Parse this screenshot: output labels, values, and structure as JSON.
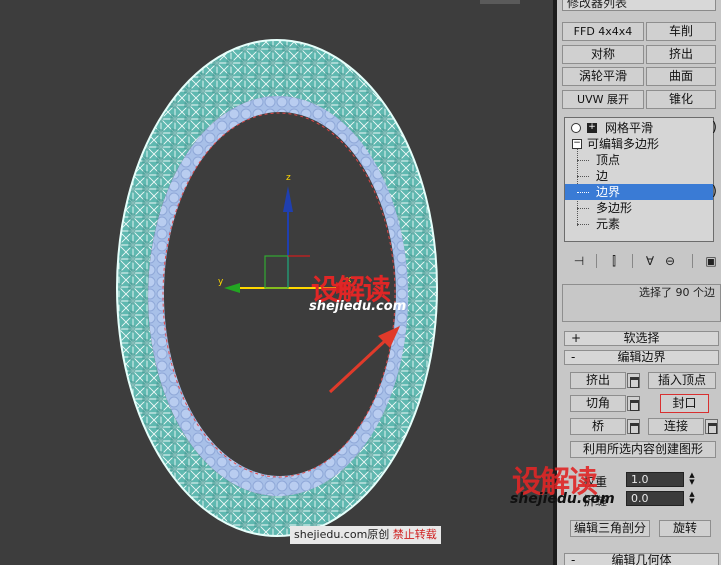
{
  "panel": {
    "modifier_list": "修改器列表",
    "modifier_buttons": [
      {
        "label": "FFD 4x4x4"
      },
      {
        "label": "车削"
      },
      {
        "label": "对称"
      },
      {
        "label": "挤出"
      },
      {
        "label": "涡轮平滑"
      },
      {
        "label": "曲面"
      },
      {
        "label": "UVW 展开"
      },
      {
        "label": "锥化"
      }
    ],
    "stack": {
      "items": [
        {
          "label": "网格平滑"
        },
        {
          "label": "可编辑多边形"
        },
        {
          "label": "顶点"
        },
        {
          "label": "边"
        },
        {
          "label": "边界"
        },
        {
          "label": "多边形"
        },
        {
          "label": "元素"
        }
      ],
      "selected_index": 4
    },
    "selection_info": "选择了 90 个边",
    "soft_selection": "软选择",
    "edit_borders": {
      "title": "编辑边界",
      "extrude": "挤出",
      "insert_vertex": "插入顶点",
      "chamfer": "切角",
      "cap": "封口",
      "bridge": "桥",
      "connect": "连接",
      "create_shape": "利用所选内容创建图形",
      "weight_label": "权重",
      "weight_value": "1.0",
      "crease_label": "折缝",
      "crease_value": "0.0",
      "edit_tri": "编辑三角剖分",
      "turn": "旋转"
    },
    "edit_geometry": "编辑几何体"
  },
  "viewport": {
    "axis_x_label": "x",
    "axis_y_label": "y",
    "axis_z_label": "z"
  },
  "watermark": {
    "logo_text": "设解读",
    "site": "shejiedu.com",
    "credit_site": "shejiedu.com",
    "credit_original": "原创",
    "credit_no_repost": "禁止转载"
  },
  "colors": {
    "ring_fill": "#5fb8b0",
    "ring_inner": "#a8c0e8",
    "selection_blue": "#3a7bd5",
    "watermark_red": "#e02626",
    "arrow_red": "#e03a2a"
  }
}
